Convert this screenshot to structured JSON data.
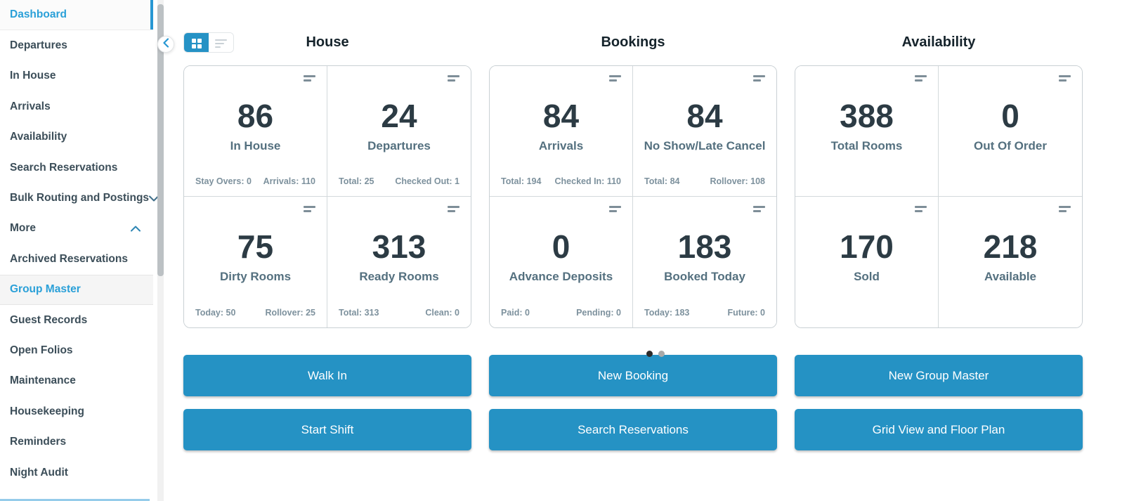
{
  "colors": {
    "accent_blue": "#2592c4",
    "link_blue": "#2aa0d8",
    "nav_text": "#3c4e59",
    "stat_number": "#2c3b44",
    "stat_label": "#54707f",
    "stat_footer": "#7d919d"
  },
  "icons": {
    "sidebar_collapse": "chevron-left-icon",
    "view_grid": "grid-view-icon",
    "view_list": "list-view-icon",
    "card_menu": "menu-lines-icon",
    "expand": "chevron-down-icon",
    "collapse": "chevron-up-icon"
  },
  "sidebar": {
    "items": [
      {
        "label": "Dashboard",
        "state": "active"
      },
      {
        "label": "Departures"
      },
      {
        "label": "In House"
      },
      {
        "label": "Arrivals"
      },
      {
        "label": "Availability"
      },
      {
        "label": "Search Reservations"
      },
      {
        "label": "Bulk Routing and Postings",
        "chevron": "down"
      },
      {
        "label": "More",
        "chevron": "up"
      },
      {
        "label": "Archived Reservations"
      },
      {
        "label": "Group Master",
        "state": "highlighted"
      },
      {
        "label": "Guest Records"
      },
      {
        "label": "Open Folios"
      },
      {
        "label": "Maintenance"
      },
      {
        "label": "Housekeeping"
      },
      {
        "label": "Reminders"
      },
      {
        "label": "Night Audit"
      }
    ]
  },
  "view_toggle": {
    "options": [
      "grid",
      "list"
    ],
    "selected": "grid"
  },
  "sections": [
    {
      "title": "House",
      "cards": [
        {
          "value": "86",
          "label": "In House",
          "stat_left": "Stay Overs: 0",
          "stat_right": "Arrivals: 110"
        },
        {
          "value": "24",
          "label": "Departures",
          "stat_left": "Total: 25",
          "stat_right": "Checked Out: 1"
        },
        {
          "value": "75",
          "label": "Dirty Rooms",
          "stat_left": "Today: 50",
          "stat_right": "Rollover: 25"
        },
        {
          "value": "313",
          "label": "Ready Rooms",
          "stat_left": "Total: 313",
          "stat_right": "Clean: 0"
        }
      ],
      "buttons": [
        "Walk In",
        "Start Shift"
      ]
    },
    {
      "title": "Bookings",
      "cards": [
        {
          "value": "84",
          "label": "Arrivals",
          "stat_left": "Total: 194",
          "stat_right": "Checked In: 110"
        },
        {
          "value": "84",
          "label": "No Show/Late Cancel",
          "stat_left": "Total: 84",
          "stat_right": "Rollover: 108"
        },
        {
          "value": "0",
          "label": "Advance Deposits",
          "stat_left": "Paid: 0",
          "stat_right": "Pending: 0"
        },
        {
          "value": "183",
          "label": "Booked Today",
          "stat_left": "Today: 183",
          "stat_right": "Future: 0"
        }
      ],
      "buttons": [
        "New Booking",
        "Search Reservations"
      ]
    },
    {
      "title": "Availability",
      "cards": [
        {
          "value": "388",
          "label": "Total Rooms",
          "stat_left": "",
          "stat_right": ""
        },
        {
          "value": "0",
          "label": "Out Of Order",
          "stat_left": "",
          "stat_right": ""
        },
        {
          "value": "170",
          "label": "Sold",
          "stat_left": "",
          "stat_right": ""
        },
        {
          "value": "218",
          "label": "Available",
          "stat_left": "",
          "stat_right": ""
        }
      ],
      "buttons": [
        "New Group Master",
        "Grid View and Floor Plan"
      ]
    }
  ],
  "carousel": {
    "page_count": 2,
    "active_page": 1
  }
}
